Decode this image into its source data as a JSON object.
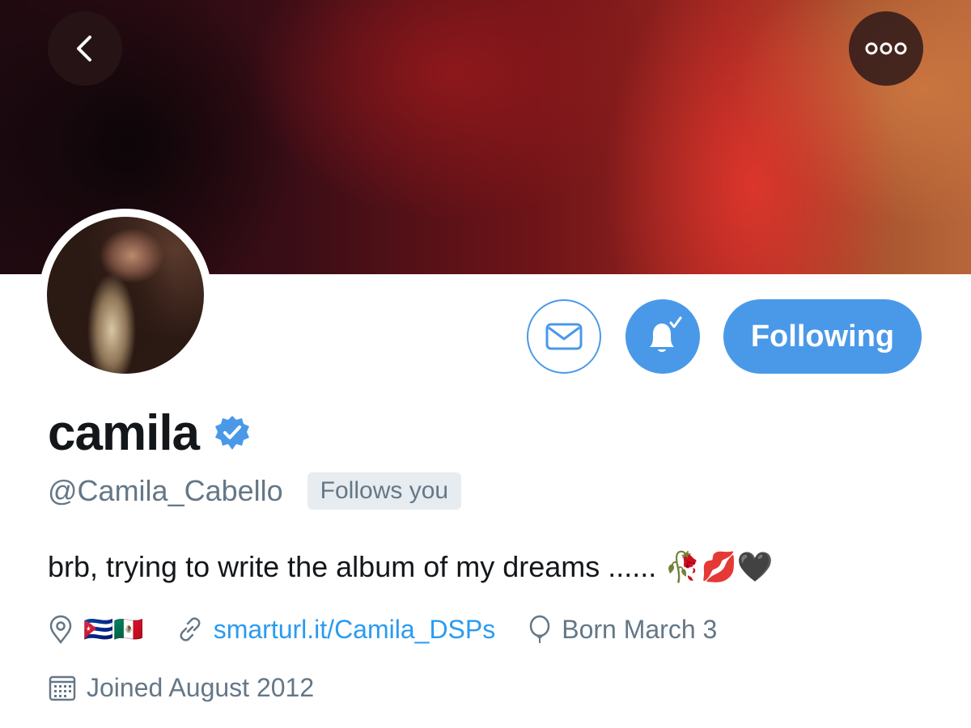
{
  "header": {
    "back_icon": "chevron-left-icon",
    "more_icon": "more-horizontal-icon"
  },
  "actions": {
    "message_icon": "envelope-icon",
    "notifications_icon": "bell-check-icon",
    "follow_label": "Following"
  },
  "profile": {
    "display_name": "camila",
    "verified_icon": "verified-badge-icon",
    "handle": "@Camila_Cabello",
    "follows_you": "Follows you",
    "bio": "brb, trying to write the album of my dreams ...... 🥀💋🖤",
    "location_flags": "🇨🇺🇲🇽",
    "website": "smarturl.it/Camila_DSPs",
    "birthday": "Born March 3",
    "joined": "Joined August 2012"
  },
  "colors": {
    "accent": "#4a99e9",
    "link": "#2b9bf0",
    "secondary_text": "#657786",
    "primary_text": "#14171a"
  }
}
